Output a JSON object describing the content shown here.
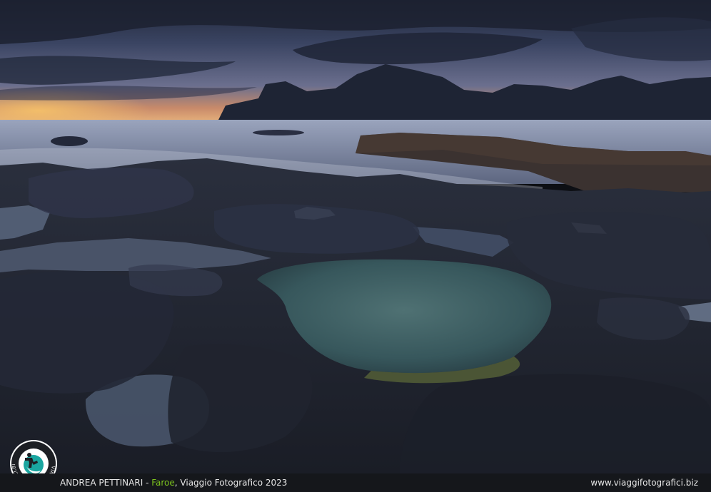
{
  "caption": {
    "author": "ANDREA PETTINARI",
    "separator": " - ",
    "location": "Faroe",
    "trip": ", Viaggio Fotografico 2023",
    "website": "www.viaggifotografici.biz"
  },
  "logo": {
    "ring_text": "VIAGGIFOTOGRAFICI.BIZ",
    "icon": "photographer-silhouette-icon"
  },
  "colors": {
    "accent": "#7cc21e",
    "caption_bar": "#15171b",
    "logo_teal": "#1aa6a0"
  }
}
